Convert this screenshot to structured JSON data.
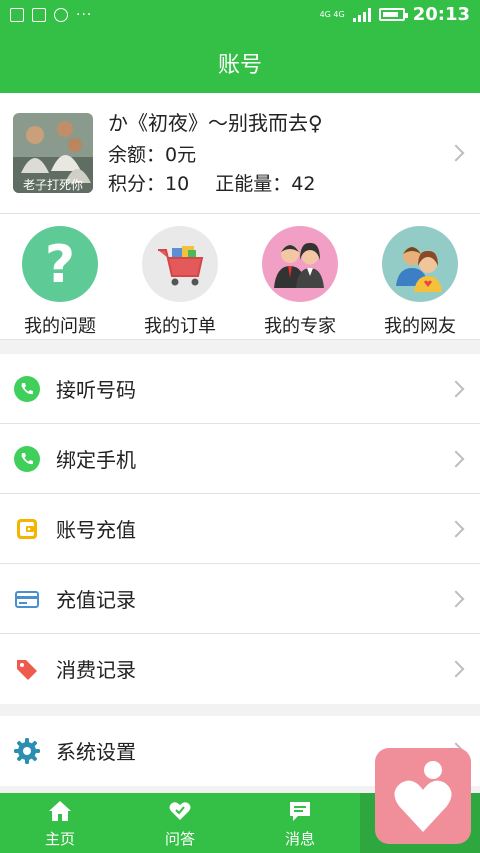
{
  "status_bar": {
    "network": "4G 4G",
    "time": "20:13",
    "battery_percent": 85
  },
  "header": {
    "title": "账号"
  },
  "profile": {
    "avatar_caption": "老子打死你",
    "name": "か《初夜》～别我而去♀",
    "balance": "余额：0元",
    "points": "积分：10",
    "energy": "正能量：42"
  },
  "shortcuts": [
    {
      "label": "我的问题",
      "icon": "question-icon",
      "color": "#5ecb96"
    },
    {
      "label": "我的订单",
      "icon": "shopping-cart-icon",
      "color": "#e9e9e9"
    },
    {
      "label": "我的专家",
      "icon": "experts-icon",
      "color": "#f29fc6"
    },
    {
      "label": "我的网友",
      "icon": "friends-icon",
      "color": "#93ccc6"
    }
  ],
  "menu_group_1": [
    {
      "label": "接听号码",
      "icon": "phone-icon"
    },
    {
      "label": "绑定手机",
      "icon": "phone-icon"
    },
    {
      "label": "账号充值",
      "icon": "wallet-icon"
    },
    {
      "label": "充值记录",
      "icon": "card-icon"
    },
    {
      "label": "消费记录",
      "icon": "tag-icon"
    }
  ],
  "menu_group_2": [
    {
      "label": "系统设置",
      "icon": "gear-icon"
    }
  ],
  "bottom_nav": [
    {
      "label": "主页",
      "icon": "home-icon"
    },
    {
      "label": "问答",
      "icon": "heart-chat-icon"
    },
    {
      "label": "消息",
      "icon": "message-icon"
    }
  ],
  "colors": {
    "brand": "#34c046",
    "fab": "#f08f9a"
  }
}
